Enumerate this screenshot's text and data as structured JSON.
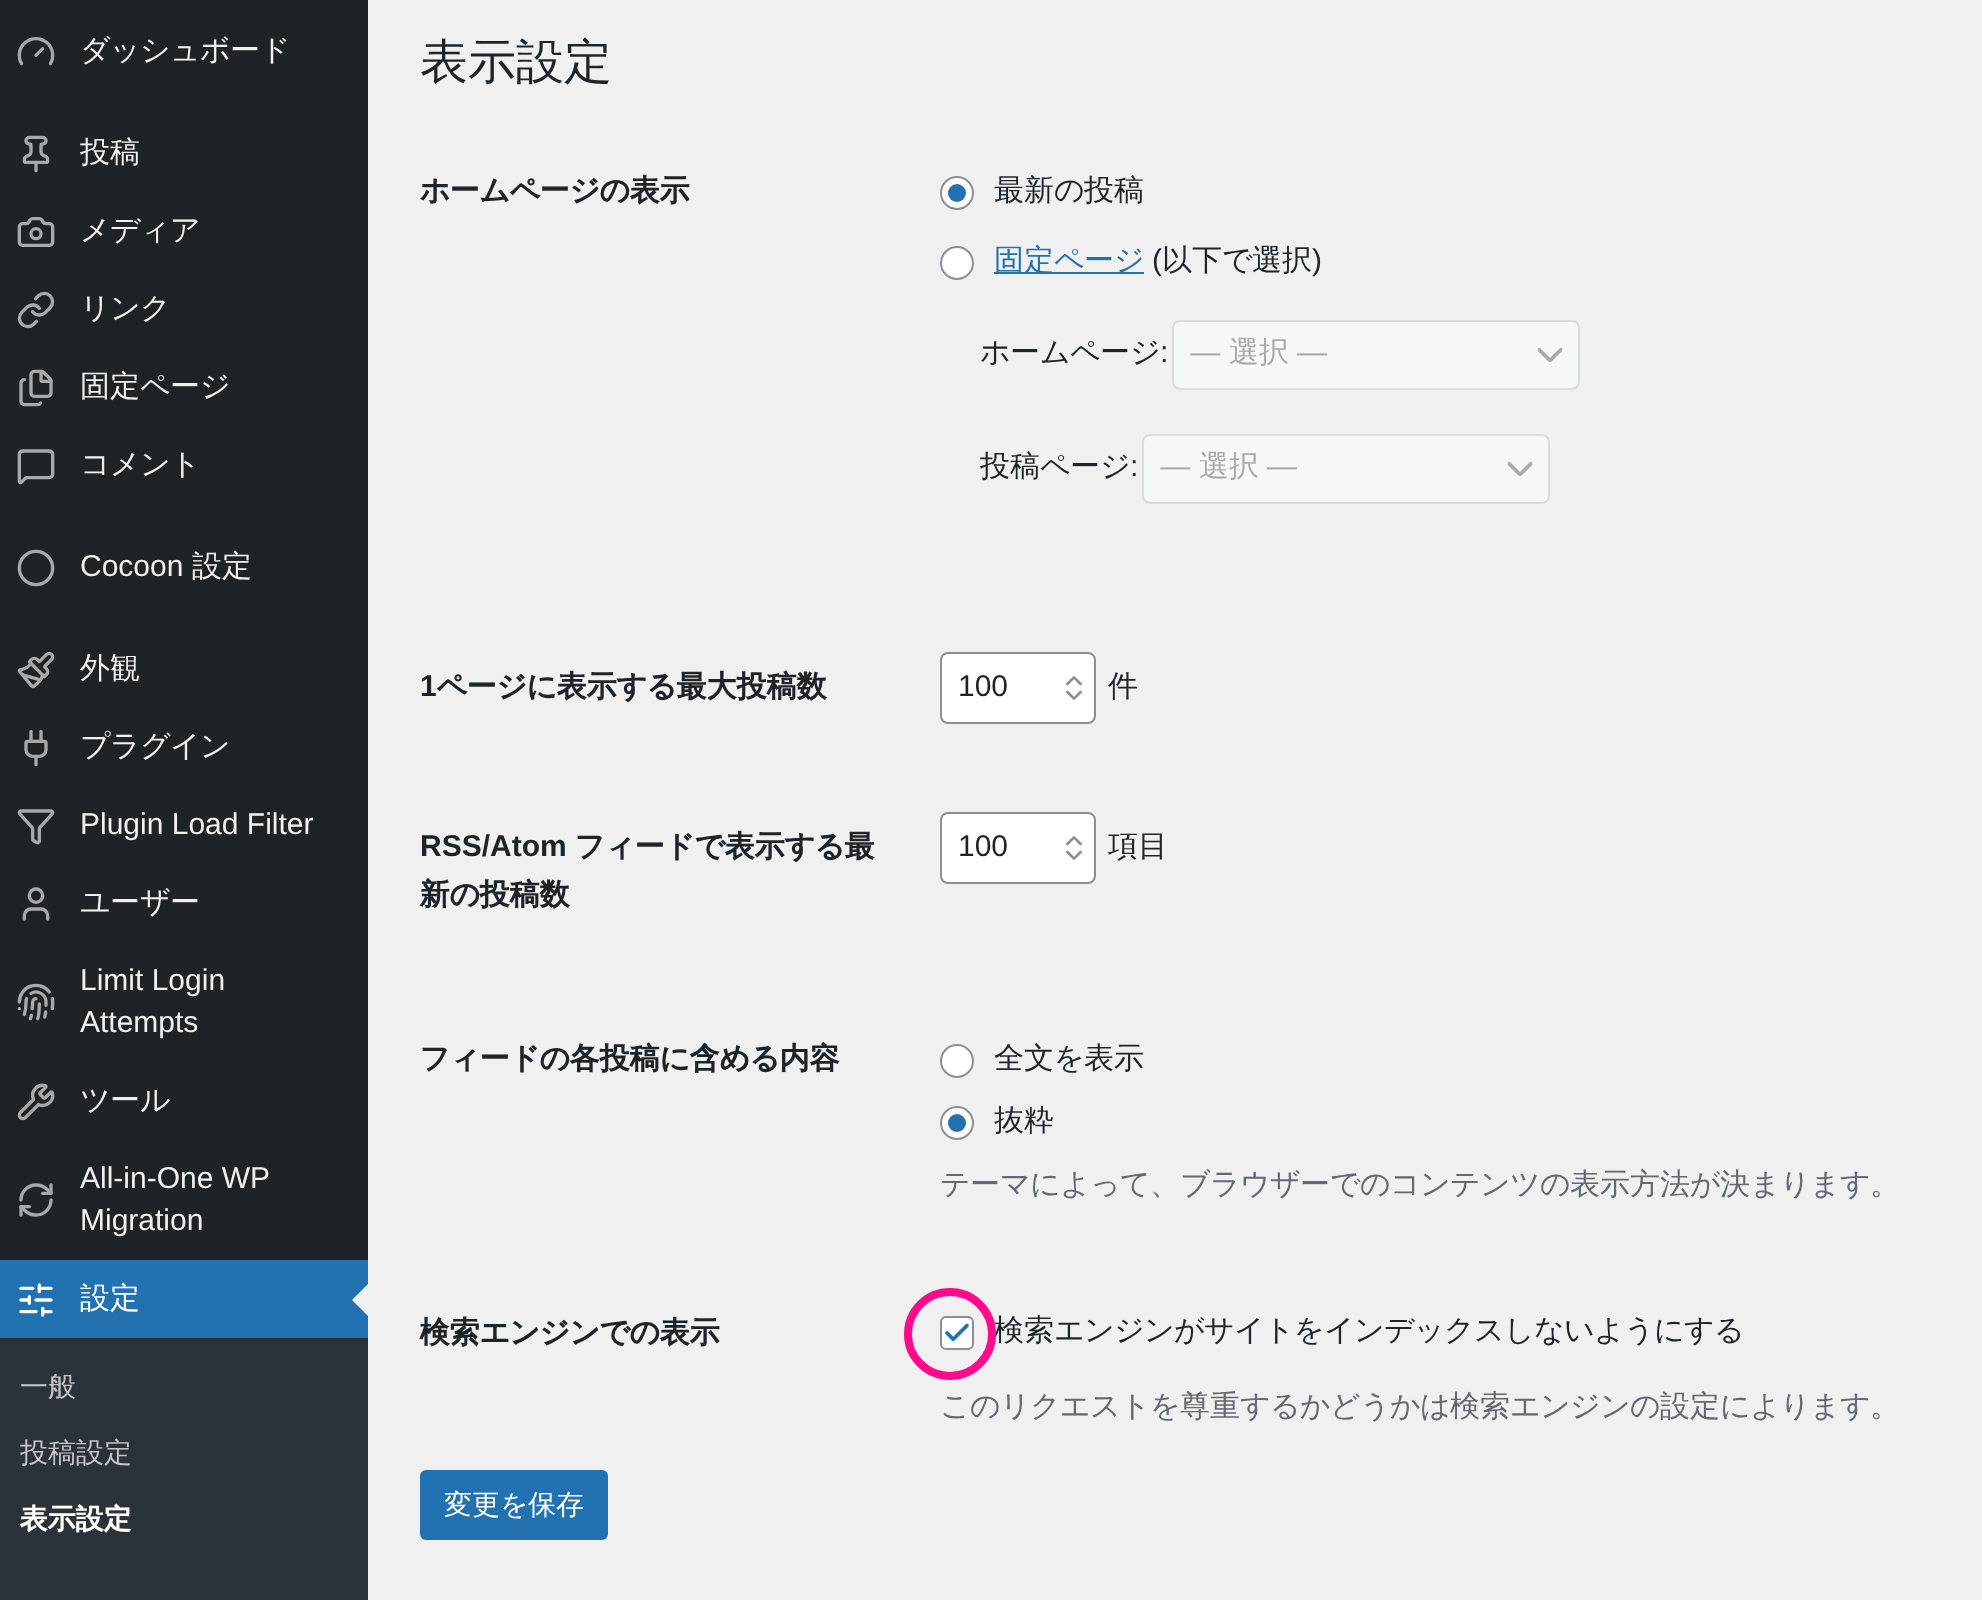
{
  "sidebar": {
    "groups": [
      [
        {
          "label": "ダッシュボード",
          "kind": "dashboard",
          "selected": false
        }
      ],
      [
        {
          "label": "投稿",
          "kind": "pin",
          "selected": false
        },
        {
          "label": "メディア",
          "kind": "media",
          "selected": false
        },
        {
          "label": "リンク",
          "kind": "link",
          "selected": false
        },
        {
          "label": "固定ページ",
          "kind": "pages",
          "selected": false
        },
        {
          "label": "コメント",
          "kind": "comment",
          "selected": false
        }
      ],
      [
        {
          "label": "Cocoon 設定",
          "kind": "circle",
          "selected": false
        }
      ],
      [
        {
          "label": "外観",
          "kind": "brush",
          "selected": false
        },
        {
          "label": "プラグイン",
          "kind": "plug",
          "selected": false
        },
        {
          "label": "Plugin Load Filter",
          "kind": "filter",
          "selected": false
        },
        {
          "label": "ユーザー",
          "kind": "user",
          "selected": false
        },
        {
          "label": "Limit Login Attempts",
          "kind": "lock",
          "selected": false
        },
        {
          "label": "ツール",
          "kind": "wrench",
          "selected": false
        },
        {
          "label": "All-in-One WP Migration",
          "kind": "migrate",
          "selected": false
        },
        {
          "label": "設定",
          "kind": "settings",
          "selected": true
        }
      ]
    ],
    "submenu": [
      {
        "label": "一般",
        "selected": false
      },
      {
        "label": "投稿設定",
        "selected": false
      },
      {
        "label": "表示設定",
        "selected": true
      }
    ]
  },
  "page": {
    "title": "表示設定",
    "homepage": {
      "label": "ホームページの表示",
      "options": [
        {
          "text": "最新の投稿",
          "selected": true
        },
        {
          "link": "固定ページ",
          "text": "(以下で選択)",
          "selected": false
        }
      ],
      "selects": [
        {
          "label": "ホームページ:",
          "placeholder": "— 選択 —"
        },
        {
          "label": "投稿ページ:",
          "placeholder": "— 選択 —"
        }
      ]
    },
    "numbers": [
      {
        "label": "1ページに表示する最大投稿数",
        "value": "100",
        "unit": "件"
      },
      {
        "label": "RSS/Atom フィードで表示する最新の投稿数",
        "value": "100",
        "unit": "項目"
      }
    ],
    "feed": {
      "label": "フィードの各投稿に含める内容",
      "options": [
        {
          "text": "全文を表示",
          "selected": false
        },
        {
          "text": "抜粋",
          "selected": true
        }
      ],
      "description": "テーマによって、ブラウザーでのコンテンツの表示方法が決まります。"
    },
    "search": {
      "label": "検索エンジンでの表示",
      "checkbox": "検索エンジンがサイトをインデックスしないようにする",
      "checked": true,
      "description": "このリクエストを尊重するかどうかは検索エンジンの設定によります。"
    },
    "save_button": "変更を保存"
  },
  "annotation": {
    "kind": "circle",
    "color": "#ff0a8c"
  }
}
